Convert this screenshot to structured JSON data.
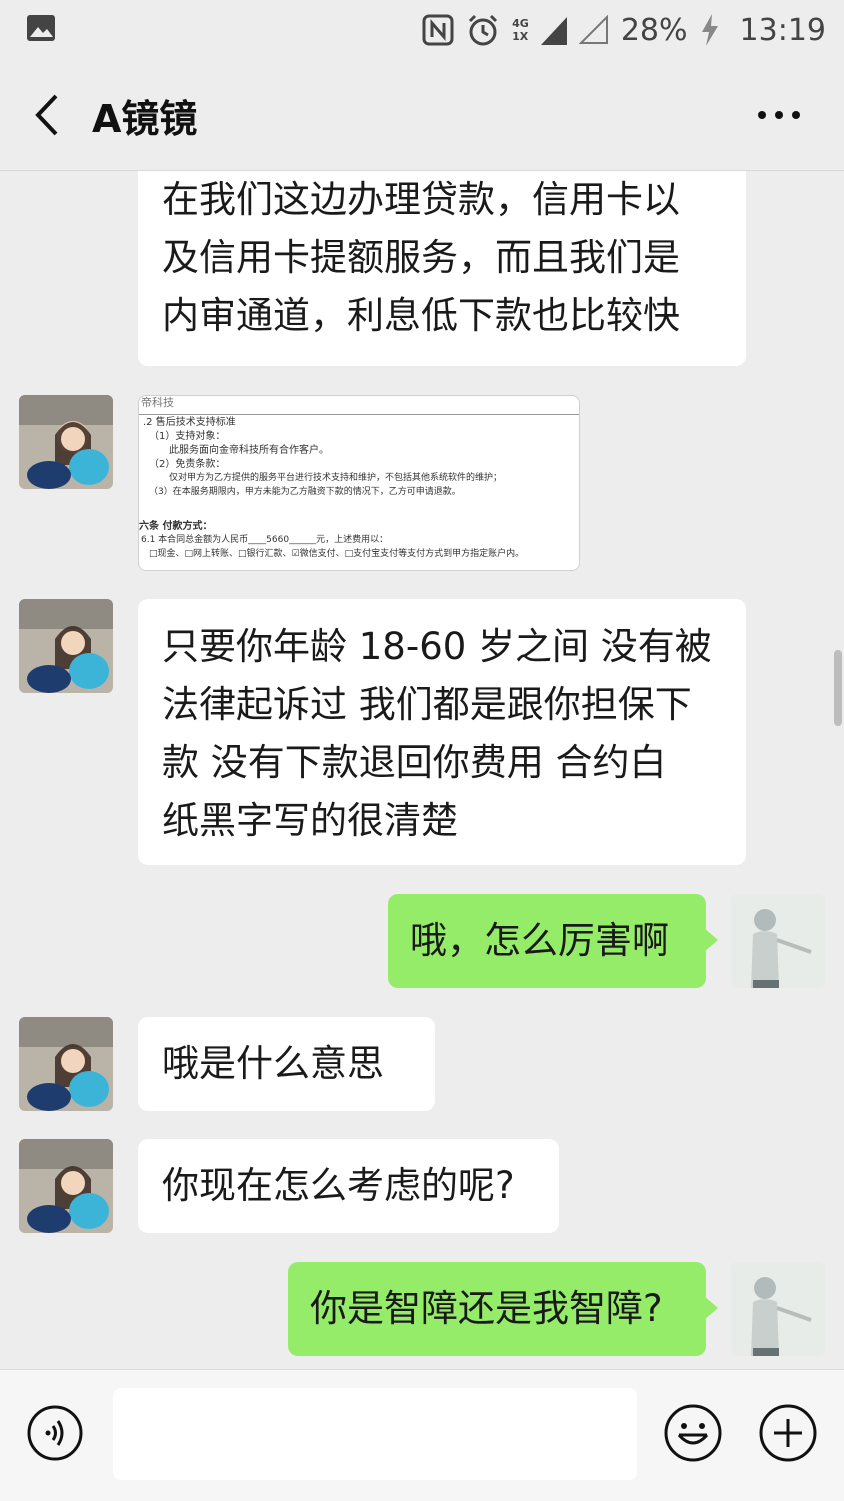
{
  "status_bar": {
    "network_label": "4G",
    "sim_label": "1X",
    "battery": "28%",
    "time": "13:19"
  },
  "header": {
    "title": "A镜镜"
  },
  "messages": [
    {
      "side": "left",
      "lines": [
        "在我们这边办理贷款，信用卡以",
        "及信用卡提额服务，而且我们是",
        "内审通道，利息低下款也比较快"
      ]
    },
    {
      "side": "left",
      "type": "image",
      "doc": {
        "header": "帝科技",
        "lines": [
          ".2 售后技术支持标准",
          "（1）支持对象：",
          "此服务面向金帝科技所有合作客户。",
          "（2）免责条款：",
          "仅对甲方为乙方提供的服务平台进行技术支持和维护，不包括其他系统软件的维护；",
          "（3）在本服务期限内，甲方未能为乙方融资下款的情况下，乙方可申请退款。",
          "六条   付款方式：",
          "6.1 本合同总金额为人民币____5660______元，上述费用以：",
          "□现金、□网上转账、□银行汇款、☑微信支付、□支付宝支付等支付方式到甲方指定账户内。"
        ]
      }
    },
    {
      "side": "left",
      "lines": [
        "只要你年龄 18-60 岁之间  没有被",
        "法律起诉过 我们都是跟你担保下",
        "款  没有下款退回你费用  合约白",
        "纸黑字写的很清楚"
      ]
    },
    {
      "side": "right",
      "lines": [
        "哦，怎么厉害啊"
      ]
    },
    {
      "side": "left",
      "lines": [
        "哦是什么意思"
      ]
    },
    {
      "side": "left",
      "lines": [
        "你现在怎么考虑的呢?"
      ]
    },
    {
      "side": "right",
      "lines": [
        "你是智障还是我智障?"
      ]
    }
  ],
  "input_bar": {
    "text_value": "",
    "voice_icon": "voice-icon",
    "emoji_icon": "emoji-icon",
    "plus_icon": "plus-icon"
  },
  "colors": {
    "background": "#ededed",
    "incoming_bubble": "#ffffff",
    "outgoing_bubble": "#95ec69"
  }
}
